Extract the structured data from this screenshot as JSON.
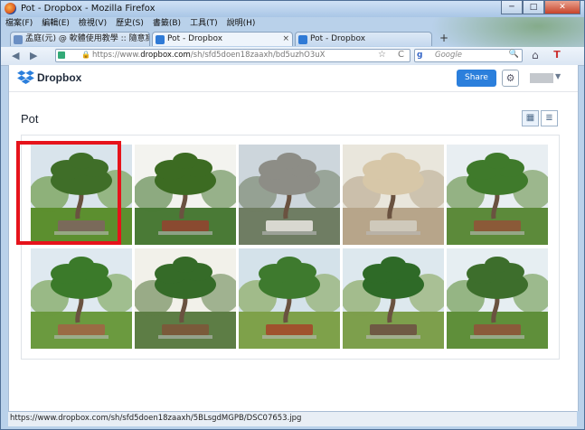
{
  "window": {
    "title": "Pot - Dropbox - Mozilla Firefox",
    "min_glyph": "─",
    "max_glyph": "□",
    "close_glyph": "✕"
  },
  "menu": [
    "檔案(F)",
    "編輯(E)",
    "檢視(V)",
    "歷史(S)",
    "書籤(B)",
    "工具(T)",
    "說明(H)"
  ],
  "tabs": [
    {
      "label": "孟庭(元) @ 軟體使用教學 :: 隨意窩 X...",
      "active": false
    },
    {
      "label": "Pot - Dropbox",
      "active": true
    },
    {
      "label": "Pot - Dropbox",
      "active": false
    }
  ],
  "nav": {
    "url_gray": "https://www.",
    "url_host": "dropbox.com",
    "url_path": "/sh/sfd5doen18zaaxh/bd5uzhO3uX",
    "search_placeholder": "Google",
    "search_engine": "g",
    "back": "◀",
    "forward": "▶",
    "star": "☆",
    "reload": "C",
    "search_icon": "🔍",
    "home": "⌂",
    "tool": "T"
  },
  "dropbox": {
    "brand": "Dropbox",
    "share_label": "Share",
    "gear_glyph": "⚙",
    "user_arrow": "▼",
    "page_title": "Pot",
    "grid_view_glyph": "▦",
    "list_view_glyph": "≣"
  },
  "status": {
    "text": "https://www.dropbox.com/sh/sfd5doen18zaaxh/5BLsgdMGPB/DSC07653.jpg"
  },
  "colors": {
    "accent": "#2b7fdc",
    "selection": "#e6131b"
  },
  "photos": [
    {
      "name": "bonsai-photo-1",
      "selected": true
    },
    {
      "name": "bonsai-photo-2",
      "selected": false
    },
    {
      "name": "bonsai-photo-3",
      "selected": false
    },
    {
      "name": "bonsai-photo-4",
      "selected": false
    },
    {
      "name": "bonsai-photo-5",
      "selected": false
    },
    {
      "name": "bonsai-photo-6",
      "selected": false
    },
    {
      "name": "bonsai-photo-7",
      "selected": false
    },
    {
      "name": "bonsai-photo-8",
      "selected": false
    },
    {
      "name": "bonsai-photo-9",
      "selected": false
    },
    {
      "name": "bonsai-photo-10",
      "selected": false
    }
  ]
}
